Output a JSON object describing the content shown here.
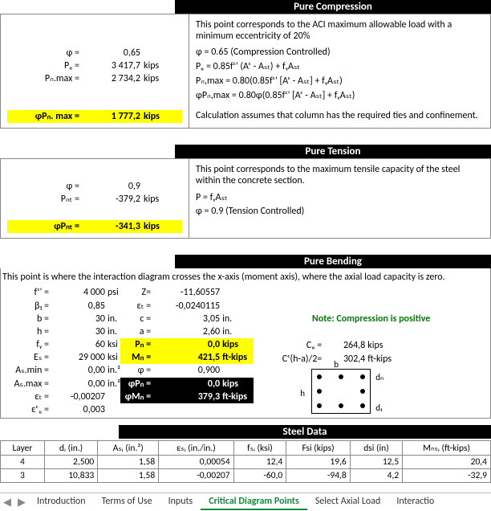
{
  "sections": {
    "pure_compression": {
      "title": "Pure Compression",
      "intro": "This point corresponds to the ACI maximum allowable load with a minimum eccentricity of 20%",
      "phi_label": "φ =",
      "phi_val": "0,65",
      "po_label": "Pₒ =",
      "po_val": "3 417,7",
      "po_unit": "kips",
      "pnmax_label": "Pₙ.max =",
      "pnmax_val": "2 734,2",
      "pnmax_unit": "kips",
      "result_label": "φPₙ. max =",
      "result_val": "1 777,2",
      "result_unit": "kips",
      "eq1": "φ = 0.65 (Compression Controlled)",
      "eq2": "Pₒ = 0.85fᶜ' (Aᶜ - Aₛₜ) + fᵧAₛₜ",
      "eq3": "Pₙ,max = 0.80(0.85fᶜ' [Aᶜ - Aₛₜ] + fᵧAₛₜ)",
      "eq4": "φPₙ,max = 0.80φ(0.85fᶜ' [Aᶜ - Aₛₜ] + fᵧAₛₜ)",
      "note": "Calculation assumes that column has the required ties and confinement."
    },
    "pure_tension": {
      "title": "Pure Tension",
      "intro": "This point corresponds to the maximum tensile capacity of the steel within the concrete section.",
      "phi_label": "φ =",
      "phi_val": "0,9",
      "pnt_label": "Pₙₜ =",
      "pnt_val": "-379,2",
      "pnt_unit": "kips",
      "result_label": "φPₙₜ =",
      "result_val": "-341,3",
      "result_unit": "kips",
      "eq1": "P = fᵧAₛₜ",
      "eq2": "φ = 0.9 (Tension Controlled)"
    },
    "pure_bending": {
      "title": "Pure Bending",
      "intro": "This point is where the interaction diagram crosses the x-axis (moment axis), where the axial load capacity is zero.",
      "left": {
        "fc_l": "fᶜ' =",
        "fc_v": "4 000",
        "fc_u": "psi",
        "b1_l": "β₁ =",
        "b1_v": "0,85",
        "b_l": "b =",
        "b_v": "30",
        "b_u": "in.",
        "h_l": "h =",
        "h_v": "30",
        "h_u": "in.",
        "fy_l": "fᵧ =",
        "fy_v": "60",
        "fy_u": "ksi",
        "es_l": "Eₛ =",
        "es_v": "29 000",
        "es_u": "ksi",
        "asmin_l": "Aₛ.min =",
        "asmin_v": "0,00",
        "asmin_u": "in.²",
        "asmax_l": "Aₛ.max =",
        "asmax_v": "0,00",
        "asmax_u": "in.²",
        "et_l": "εₜ =",
        "et_v": "-0,00207",
        "ecu_l": "εᶜᵤ =",
        "ecu_v": "0,003"
      },
      "mid": {
        "z_l": "Z=",
        "z_v": "-11,60557",
        "et_l": "εₜ =",
        "et_v": "-0,0240115",
        "c_l": "c =",
        "c_v": "3,05",
        "c_u": "in.",
        "a_l": "a =",
        "a_v": "2,60",
        "a_u": "in.",
        "pn_l": "Pₙ =",
        "pn_v": "0,0",
        "pn_u": "kips",
        "mn_l": "Mₙ =",
        "mn_v": "421,5",
        "mn_u": "ft-kips",
        "phi_l": "φ =",
        "phi_v": "0,900",
        "ppn_l": "φPₙ =",
        "ppn_v": "0,0",
        "ppn_u": "kips",
        "pmn_l": "φMₙ =",
        "pmn_v": "379,3",
        "pmn_u": "ft-kips"
      },
      "note": "Note: Compression is positive",
      "right": {
        "co_l": "Cₒ =",
        "co_v": "264,8",
        "co_u": "kips",
        "cc_l": "Cᶜ(h-a)/2=",
        "cc_v": "302,4",
        "cc_u": "ft-kips"
      },
      "diagram": {
        "b": "b",
        "h": "h",
        "dn": "dₙ",
        "d1": "d₁"
      }
    },
    "steel_data": {
      "title": "Steel Data",
      "headers": [
        "Layer",
        "dᵢ (in.)",
        "Aₛᵢ (in.²)",
        "εₛᵢ (in./in.)",
        "fₛᵢ (ksi)",
        "Fsi (kips)",
        "dsi (in)",
        "Mₙₛᵢ (ft-kips)"
      ],
      "rows": [
        [
          "4",
          "2,500",
          "1,58",
          "0,00054",
          "12,4",
          "19,6",
          "12,5",
          "20,4"
        ],
        [
          "3",
          "10,833",
          "1,58",
          "-0,00207",
          "-60,0",
          "-94,8",
          "4,2",
          "-32,9"
        ]
      ]
    }
  },
  "tabs": {
    "items": [
      "Introduction",
      "Terms of Use",
      "Inputs",
      "Critical Diagram Points",
      "Select Axial Load",
      "Interactio"
    ],
    "active_index": 3
  }
}
